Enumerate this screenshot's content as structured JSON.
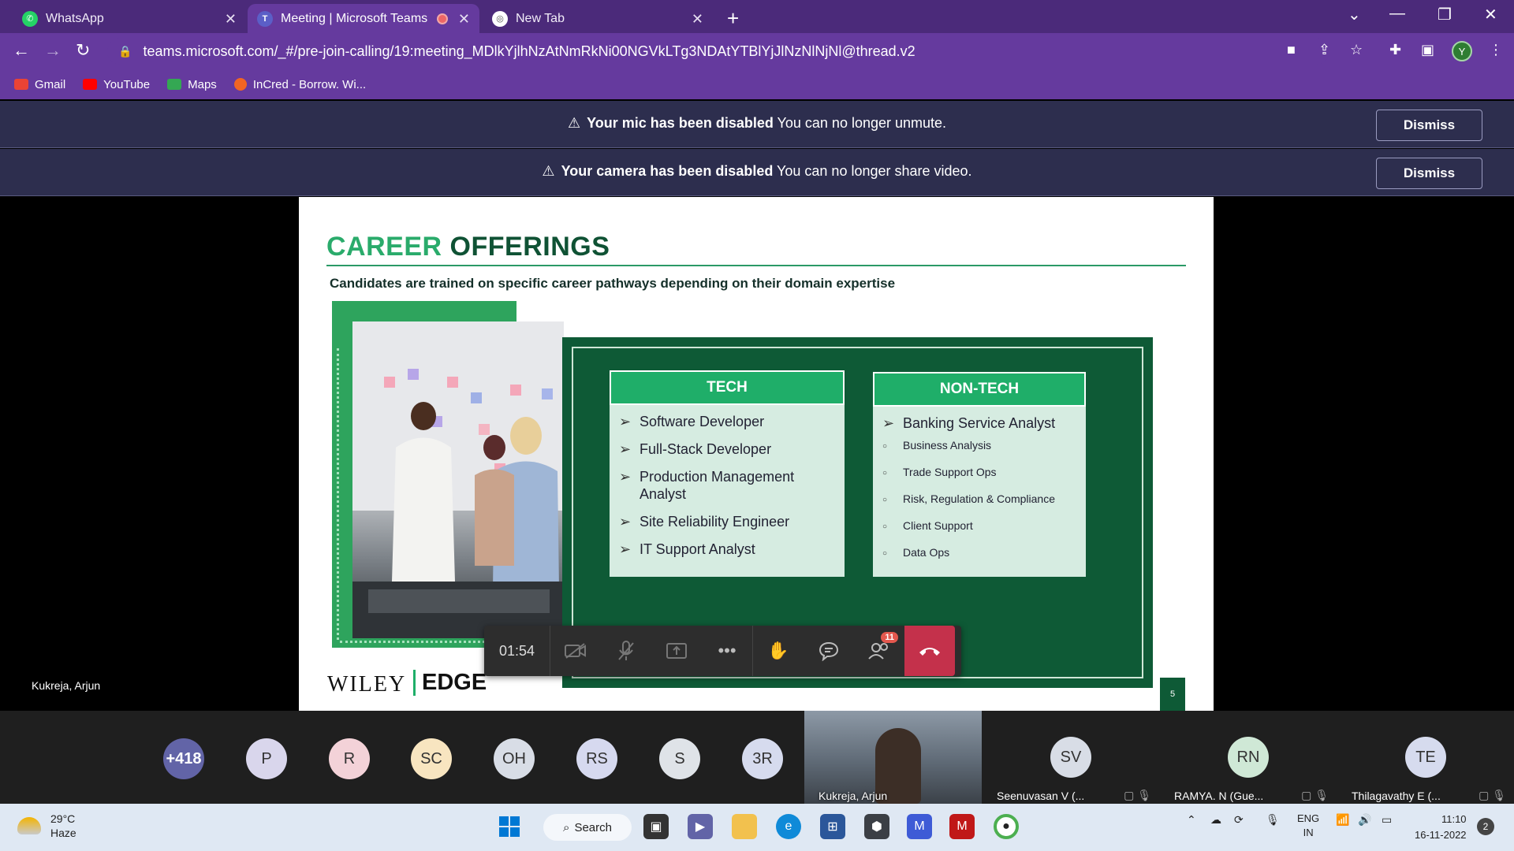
{
  "browser": {
    "tabs": [
      {
        "label": "WhatsApp",
        "icon": "whatsapp-icon"
      },
      {
        "label": "Meeting | Microsoft Teams",
        "icon": "teams-icon"
      },
      {
        "label": "New Tab",
        "icon": "chrome-icon"
      }
    ],
    "url": "teams.microsoft.com/_#/pre-join-calling/19:meeting_MDlkYjlhNzAtNmRkNi00NGVkLTg3NDAtYTBlYjJlNzNlNjNl@thread.v2",
    "profile_initial": "Y",
    "bookmarks": [
      {
        "label": "Gmail",
        "color": "#ea4335"
      },
      {
        "label": "YouTube",
        "color": "#ff0000"
      },
      {
        "label": "Maps",
        "color": "#34a853"
      },
      {
        "label": "InCred - Borrow. Wi...",
        "color": "#f26522"
      }
    ]
  },
  "banners": [
    {
      "bold": "Your mic has been disabled",
      "text": "You can no longer unmute.",
      "button": "Dismiss"
    },
    {
      "bold": "Your camera has been disabled",
      "text": "You can no longer share video.",
      "button": "Dismiss"
    }
  ],
  "slide": {
    "title_part1": "CAREER",
    "title_part2": "OFFERINGS",
    "subtitle": "Candidates are trained on specific career pathways depending on their domain expertise",
    "tech": {
      "heading": "TECH",
      "items": [
        "Software Developer",
        "Full-Stack Developer",
        "Production Management Analyst",
        "Site Reliability Engineer",
        "IT Support Analyst"
      ]
    },
    "nontech": {
      "heading": "NON-TECH",
      "main_item": "Banking Service Analyst",
      "sub_items": [
        "Business Analysis",
        "Trade Support Ops",
        "Risk, Regulation & Compliance",
        "Client Support",
        "Data Ops"
      ]
    },
    "logo_wiley": "WILEY",
    "logo_edge": "EDGE",
    "page_number": "5"
  },
  "presenter_name": "Kukreja, Arjun",
  "call": {
    "timer": "01:54",
    "participants_badge": "11"
  },
  "participants": {
    "overflow": "+418",
    "avatars": [
      {
        "initials": "P",
        "color": "#d9d6ec"
      },
      {
        "initials": "R",
        "color": "#f3d2d8"
      },
      {
        "initials": "SC",
        "color": "#f8e5c0"
      },
      {
        "initials": "OH",
        "color": "#d8dde6"
      },
      {
        "initials": "RS",
        "color": "#d6d9ef"
      },
      {
        "initials": "S",
        "color": "#dfe3e8"
      },
      {
        "initials": "3R",
        "color": "#d6dbee"
      }
    ],
    "video_name": "Kukreja, Arjun",
    "tiles": [
      {
        "initials": "SV",
        "name": "Seenuvasan V (...",
        "color": "#d8dde6"
      },
      {
        "initials": "RN",
        "name": "RAMYA. N (Gue...",
        "color": "#cfe8d6"
      },
      {
        "initials": "TE",
        "name": "Thilagavathy E (...",
        "color": "#d6dbee"
      }
    ]
  },
  "taskbar": {
    "temp": "29°C",
    "condition": "Haze",
    "search": "Search",
    "lang1": "ENG",
    "lang2": "IN",
    "time": "11:10",
    "date": "16-11-2022",
    "notifications": "2"
  }
}
